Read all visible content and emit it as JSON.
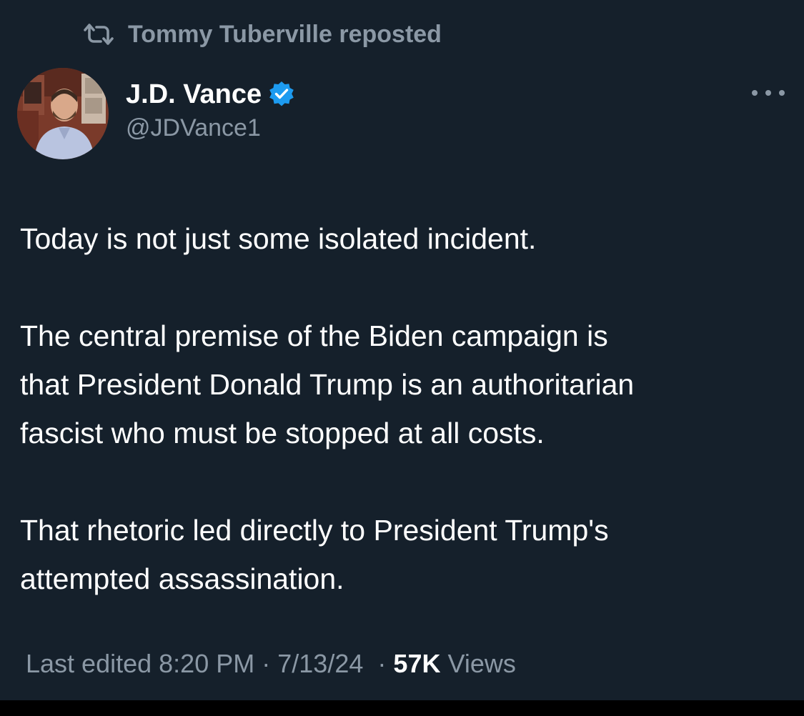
{
  "repost": {
    "label": "Tommy Tuberville reposted",
    "icon": "repost-icon"
  },
  "author": {
    "name": "J.D. Vance",
    "handle": "@JDVance1",
    "verified": true,
    "verified_icon": "verified-badge-icon",
    "verified_color": "#1d9bf0"
  },
  "menu": {
    "icon": "more-options-icon"
  },
  "post": {
    "paragraphs": [
      "Today is not just some isolated incident.",
      "The central premise of the Biden campaign is\nthat President Donald Trump is an authoritarian\nfascist who must be stopped at all costs.",
      "That rhetoric led directly to President Trump's\nattempted assassination."
    ]
  },
  "meta": {
    "edited_prefix": "Last edited",
    "time": "8:20 PM",
    "date": "7/13/24",
    "separator": "·",
    "views_count": "57K",
    "views_label": "Views"
  },
  "colors": {
    "background": "#15202b",
    "text": "#ffffff",
    "secondary_text": "#8b98a5"
  }
}
